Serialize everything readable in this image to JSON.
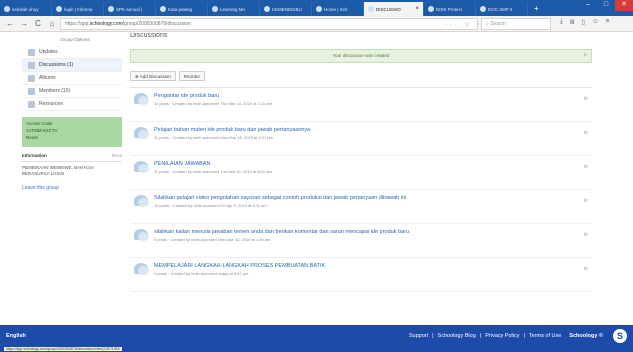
{
  "tabs": [
    {
      "label": "sekolah uhuy"
    },
    {
      "label": "login | Informa"
    },
    {
      "label": "SPK annual |"
    },
    {
      "label": "Kata pelang"
    },
    {
      "label": "Learning Mo"
    },
    {
      "label": "KEMENDIKBU"
    },
    {
      "label": "Home | Sch"
    },
    {
      "label": "DISCUSSIO",
      "active": true
    },
    {
      "label": "DISK Protect"
    },
    {
      "label": "DOC-2MP 3"
    }
  ],
  "browser": {
    "url_prefix": "https://app.",
    "url_host": "schoology.com",
    "url_path": "/group/2000300878/discussion",
    "search_placeholder": "Search",
    "newtab": "+",
    "nav": {
      "back": "←",
      "forward": "→",
      "reload": "C",
      "home": "⌂"
    }
  },
  "sidebar": {
    "top_link": "Group Options",
    "items": [
      {
        "label": "Updates"
      },
      {
        "label": "Discussions (1)",
        "active": true
      },
      {
        "label": "Albums"
      },
      {
        "label": "Members (10)"
      },
      {
        "label": "Resources"
      }
    ],
    "access": {
      "title": "Access Code",
      "code": "XJTMM-6XCTV",
      "reset": "Reset"
    },
    "info": {
      "title": "Information",
      "more": "More",
      "desc": "PEMBINAAN WEWEWE, BAHAGIA BERASURSA LIHAN"
    },
    "leave": "Leave this group"
  },
  "main": {
    "heading": "Discussions",
    "notice": "Your discussion was created",
    "buttons": {
      "add": "Add Discussion",
      "reorder": "Reorder"
    },
    "discussions": [
      {
        "title": "Pengantar ide produk baru",
        "meta": "11 posts · Created by ninih-autonomi Thu Mar 14, 2019 at 1:10 am"
      },
      {
        "title": "Pelajari bahan materi ide produk baru dan jawab pertanyaannya.",
        "meta": "11 posts · Created by ninih-autonomi Mon Mar 18, 2019 at 2:21 pm"
      },
      {
        "title": "PENILAIAN JAWABAN",
        "meta": "11 posts · Created by ninih-autonomi Tue Mar 19, 2019 at 8:01 am"
      },
      {
        "title": "Silahkan pelajari video pengolahan sayuran sebagai contoh produksi dan jawab pertanyaan dibawah ini",
        "meta": "10 posts · Created by ninih-autonomi Fri Apr 5, 2019 at 8:11 am"
      },
      {
        "title": "silahkan kalian menulis jawaban temen anda dan berikan komentar dan saran mencapai ide produk baru.",
        "meta": "5 posts · Created by ninih-autonomi Wed Apr 10, 2019 at 1:00 am"
      },
      {
        "title": "MEMPELAJARI LANGKAH-LANGKAH PROSES PEMBUATAN BATIK",
        "meta": "0 posts · Created by ninih-autonomi today at 8:07 pm"
      }
    ]
  },
  "footer": {
    "language": "English",
    "links": [
      "Support",
      "|",
      "Schoology Blog",
      "|",
      "Privacy Policy",
      "|",
      "Terms of Use"
    ],
    "brand": "Schoology ©",
    "logo": "S"
  },
  "statusbar": "https://app.schoology.com/group/2000300878/discussion/view/2187/1959"
}
